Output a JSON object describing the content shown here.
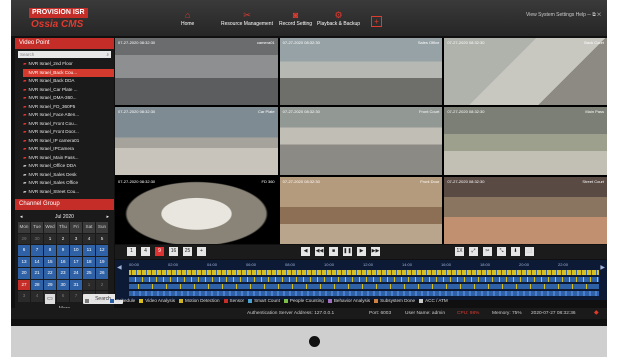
{
  "brand": {
    "name": "PROVISION ISR",
    "product": "Ossia CMS"
  },
  "nav": [
    {
      "label": "Home",
      "icon": "home-icon"
    },
    {
      "label": "Resource Management",
      "icon": "tools-icon"
    },
    {
      "label": "Record Setting",
      "icon": "camera-icon"
    },
    {
      "label": "Playback & Backup",
      "icon": "playback-icon"
    }
  ],
  "add_tab": "+",
  "top_links": "View System Settings Help  ─  ⧉  ✕",
  "left_panel": {
    "title": "Video Point",
    "search_placeholder": "Search",
    "devices": [
      "NVR Israel_2nd Floor",
      "NVR Israel_Back Cou...",
      "NVR Israel_Back DDA",
      "NVR Israel_Car Plate ...",
      "NVR Israel_DMA-360...",
      "NVR Israel_FD_360P5",
      "NVR Israel_Face Atten...",
      "NVR Israel_Front Cou...",
      "NVR Israel_Front Door...",
      "NVR Israel_IP camera01",
      "NVR Israel_IPCamera",
      "NVR Israel_Main Pass...",
      "NVR Israel_Office DDA",
      "NVR Israel_Sales Desk",
      "NVR Israel_Sales Office",
      "NVR Israel_Street Cou..."
    ],
    "selected_index": 1,
    "gray_from_index": 12
  },
  "channel_group": {
    "title": "Channel Group",
    "month": "Jul",
    "year": "2020",
    "weekdays": [
      "Mon",
      "Tue",
      "Wed",
      "Thu",
      "Fri",
      "Sat",
      "Sun"
    ],
    "days": [
      "29",
      "30",
      "1",
      "2",
      "3",
      "4",
      "5",
      "6",
      "7",
      "8",
      "9",
      "10",
      "11",
      "12",
      "13",
      "14",
      "15",
      "16",
      "17",
      "18",
      "19",
      "20",
      "21",
      "22",
      "23",
      "24",
      "25",
      "26",
      "27",
      "28",
      "29",
      "30",
      "31",
      "1",
      "2",
      "3",
      "4",
      "5",
      "6",
      "7",
      "8",
      "9"
    ],
    "more": "More",
    "search_button": "Search"
  },
  "videos": [
    {
      "name": "camera01",
      "time": "07-27-2020 08:32:30"
    },
    {
      "name": "Sales Office",
      "time": "07-27-2020 08:32:30"
    },
    {
      "name": "Back Court",
      "time": "07-27-2020 08:32:30"
    },
    {
      "name": "Car Plate",
      "time": "07-27-2020 08:32:30"
    },
    {
      "name": "Front Court",
      "time": "07-27-2020 08:32:30"
    },
    {
      "name": "Main Pass",
      "time": "07-27-2020 08:32:30"
    },
    {
      "name": "FD 360",
      "time": "07-27-2020 08:32:30"
    },
    {
      "name": "Front Door",
      "time": "07-27-2020 08:32:30"
    },
    {
      "name": "Street Court",
      "time": "07-27-2020 08:32:30"
    }
  ],
  "controls": {
    "left": [
      "1",
      "4",
      "9",
      "16",
      "25",
      "+"
    ],
    "center": [
      "◀",
      "◀◀",
      "■",
      "❚❚",
      "▶",
      "▶▶"
    ],
    "right": [
      "1X",
      "⤢",
      "✂",
      "⤡",
      "⬇",
      "⬜"
    ]
  },
  "timeline": {
    "hours": [
      "00:00",
      "02:00",
      "04:00",
      "06:00",
      "08:00",
      "10:00",
      "12:00",
      "14:00",
      "16:00",
      "18:00",
      "20:00",
      "22:00"
    ]
  },
  "legend": [
    {
      "label": "Manual",
      "color": "#7a7a7a"
    },
    {
      "label": "Schedule",
      "color": "#2f61a6"
    },
    {
      "label": "Video Analysis",
      "color": "#d8c020"
    },
    {
      "label": "Motion Detection",
      "color": "#cdb52a"
    },
    {
      "label": "Sensor",
      "color": "#c42d28"
    },
    {
      "label": "Smart Count",
      "color": "#4aa0d0"
    },
    {
      "label": "People Counting",
      "color": "#7bbf4a"
    },
    {
      "label": "Behavior Analysis",
      "color": "#a070c0"
    },
    {
      "label": "Subsystem Done",
      "color": "#d08040"
    },
    {
      "label": "ACC / ATM",
      "color": "#cccccc"
    }
  ],
  "status": {
    "auth": "Authentication Server  Address: 127.0.0.1",
    "port": "Port: 6003",
    "user": "User Name: admin",
    "cpu": "CPU: 98%",
    "memory": "Memory: 75%",
    "datetime": "2020-07-27 08:32:36"
  },
  "colors": {
    "accent": "#c42d28",
    "panel": "#1a1a1a",
    "timeline": "#0d1a35"
  }
}
